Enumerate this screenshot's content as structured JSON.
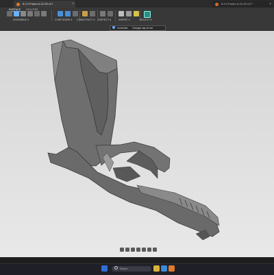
{
  "window": {
    "tabs": [
      {
        "label": "8.2.0 Frame A-22-25 v17",
        "active": true
      },
      {
        "label": "8.2.0 Frame A-22-25 v17*",
        "active": false
      }
    ]
  },
  "ribbon": {
    "tabs": [
      "SURFACE",
      "UTILITIES"
    ],
    "active_tab": "SURFACE",
    "groups": [
      {
        "label": "ASSEMBLE ▾"
      },
      {
        "label": "CONFIGURE ▾"
      },
      {
        "label": "CONSTRUCT ▾"
      },
      {
        "label": "INSPECT ▾"
      },
      {
        "label": "INSERT ▾"
      },
      {
        "label": "SELECT ▾"
      }
    ],
    "colors": {
      "accent": "#6bb0ff",
      "brand": "#e07a2e"
    }
  },
  "notification": {
    "title": "Connected",
    "message": "Changes may be lost"
  },
  "viewport": {
    "model_name": "pistol frame body"
  },
  "bottom_nav": {
    "tools": [
      "orbit",
      "pan",
      "zoom",
      "fit",
      "display"
    ]
  },
  "taskbar": {
    "search_placeholder": "Search"
  }
}
